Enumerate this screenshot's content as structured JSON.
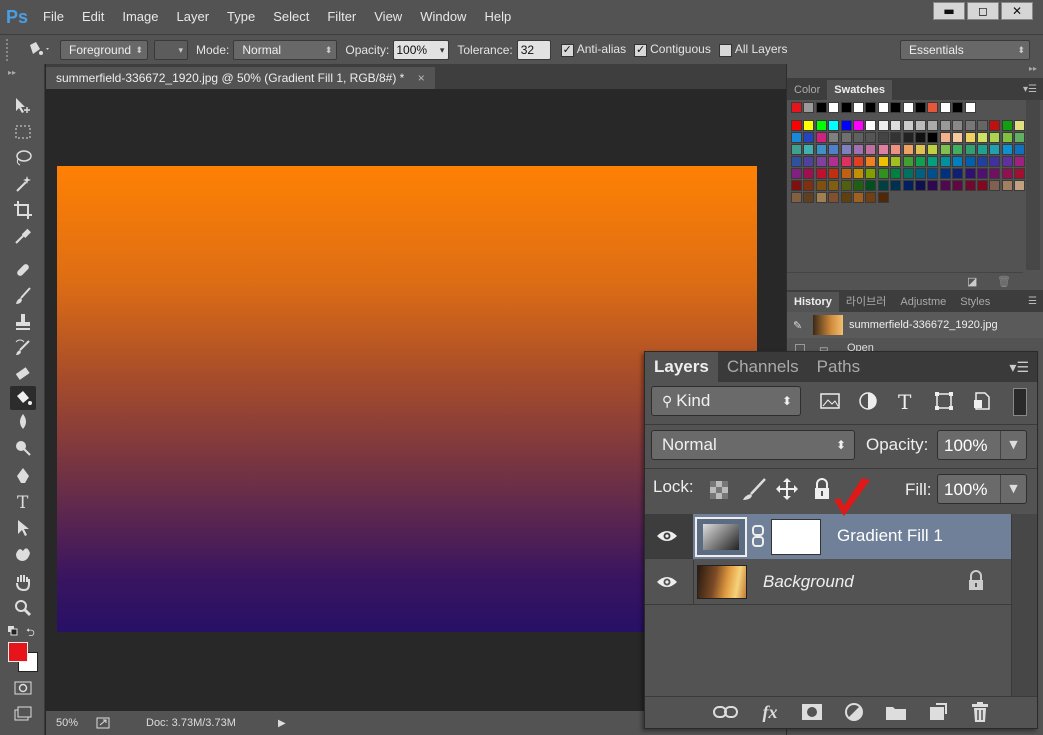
{
  "app": {
    "logo": "Ps"
  },
  "menu": [
    "File",
    "Edit",
    "Image",
    "Layer",
    "Type",
    "Select",
    "Filter",
    "View",
    "Window",
    "Help"
  ],
  "window_buttons": {
    "minimize": "▬",
    "restore": "◻",
    "close": "✕"
  },
  "options": {
    "preset": "Foreground",
    "mode_label": "Mode:",
    "mode_value": "Normal",
    "opacity_label": "Opacity:",
    "opacity_value": "100%",
    "tolerance_label": "Tolerance:",
    "tolerance_value": "32",
    "anti_alias": "Anti-alias",
    "contiguous": "Contiguous",
    "all_layers": "All Layers",
    "workspace": "Essentials"
  },
  "document": {
    "tab_title": "summerfield-336672_1920.jpg @ 50% (Gradient Fill 1, RGB/8#) *",
    "close": "×",
    "zoom": "50%",
    "doc_size": "Doc: 3.73M/3.73M",
    "gradient_colors": [
      "#ff8104",
      "#271066"
    ]
  },
  "colors": {
    "foreground": "#e8141c",
    "background": "#ffffff",
    "accent": "#4a9ee6",
    "selected_layer": "#6f8098"
  },
  "swatches_panel": {
    "tabs": [
      "Color",
      "Swatches"
    ],
    "active": "Swatches"
  },
  "history_panel": {
    "tabs": [
      "History",
      "라이브러",
      "Adjustme",
      "Styles"
    ],
    "items": [
      {
        "label": "summerfield-336672_1920.jpg"
      },
      {
        "label": "Open"
      }
    ]
  },
  "layers_panel": {
    "tabs": [
      "Layers",
      "Channels",
      "Paths"
    ],
    "filter_kind": "Kind",
    "blend_mode": "Normal",
    "opacity_label": "Opacity:",
    "opacity_value": "100%",
    "lock_label": "Lock:",
    "fill_label": "Fill:",
    "fill_value": "100%",
    "layers": [
      {
        "name": "Gradient Fill 1",
        "selected": true
      },
      {
        "name": "Background",
        "locked": true
      }
    ]
  }
}
